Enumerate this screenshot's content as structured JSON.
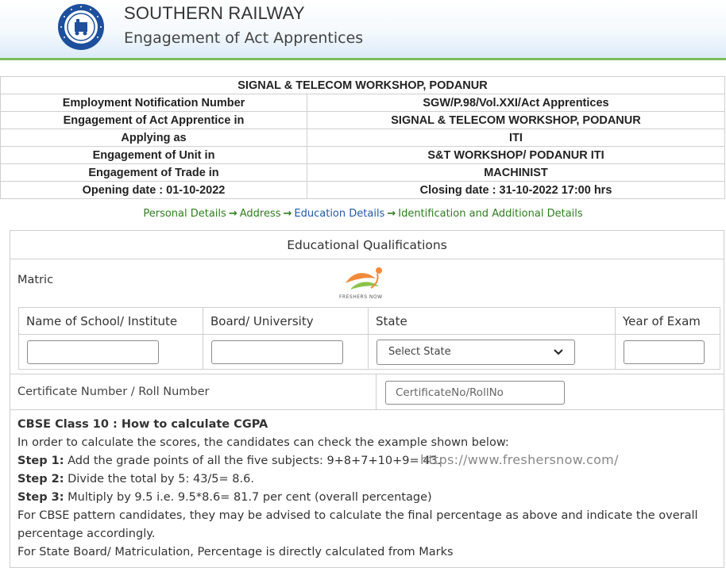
{
  "header": {
    "title": "SOUTHERN RAILWAY",
    "subtitle": "Engagement of Act Apprentices",
    "logo_text": "INDIAN RAILWAYS"
  },
  "info": {
    "heading": "SIGNAL & TELECOM WORKSHOP, PODANUR",
    "rows": [
      {
        "label": "Employment Notification Number",
        "value": "SGW/P.98/Vol.XXI/Act Apprentices"
      },
      {
        "label": "Engagement of Act Apprentice in",
        "value": "SIGNAL & TELECOM WORKSHOP, PODANUR"
      },
      {
        "label": "Applying as",
        "value": "ITI"
      },
      {
        "label": "Engagement of Unit in",
        "value": "S&T WORKSHOP/ PODANUR ITI"
      },
      {
        "label": "Engagement of Trade in",
        "value": "MACHINIST"
      },
      {
        "label": "Opening date : 01-10-2022",
        "value": "Closing date : 31-10-2022 17:00 hrs"
      }
    ]
  },
  "steps": [
    "Personal Details",
    "Address",
    "Education Details",
    "Identification and Additional Details"
  ],
  "step_arrow": "→",
  "form": {
    "title": "Educational Qualifications",
    "section": "Matric",
    "watermark_text": "FRESHERS NOW",
    "columns": [
      "Name of School/ Institute",
      "Board/ University",
      "State",
      "Year of Exam"
    ],
    "school_value": "",
    "board_value": "",
    "state_selected": "Select State",
    "year_value": "",
    "cert_label": "Certificate Number / Roll Number",
    "cert_placeholder": "CertificateNo/RollNo"
  },
  "note": {
    "title": "CBSE Class 10 : How to calculate CGPA",
    "intro": "In order to calculate the scores, the candidates can check the example shown below:",
    "step1_label": "Step 1:",
    "step1_text": " Add the grade points of all the five subjects: 9+8+7+10+9= 43.",
    "step2_label": "Step 2:",
    "step2_text": " Divide the total by 5: 43/5= 8.6.",
    "step3_label": "Step 3:",
    "step3_text": " Multiply by 9.5 i.e. 9.5*8.6= 81.7 per cent (overall percentage)",
    "cbse_text": "For CBSE pattern candidates, they may be advised to calculate the final percentage as above and indicate the overall percentage accordingly.",
    "state_text": "For State Board/ Matriculation, Percentage is directly calculated from Marks",
    "watermark_url": "https://www.freshersnow.com/"
  },
  "colors": {
    "accent_green": "#7bbd5c",
    "step_green": "#2e7d1e",
    "step_active": "#1f5aa8"
  }
}
